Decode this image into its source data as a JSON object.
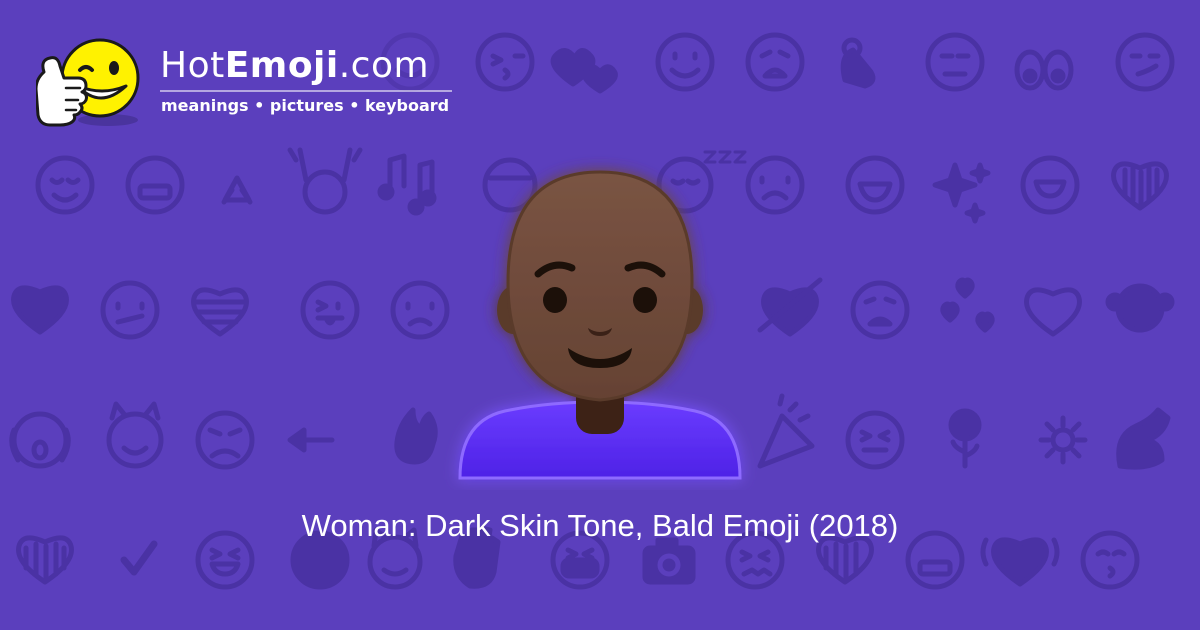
{
  "logo": {
    "name_part1": "Hot",
    "name_part2": "Emoji",
    "name_part3": ".com",
    "tagline": "meanings • pictures • keyboard",
    "mascot_icon": "thumbs-up-winking-smiley-icon"
  },
  "caption": "Woman: Dark Skin Tone, Bald Emoji (2018)",
  "featured_emoji_icon": "woman-dark-skin-tone-bald-icon",
  "background_pattern_icons": [
    "smiling-face-icon",
    "winking-kiss-icon",
    "two-hearts-icon",
    "weary-face-icon",
    "ok-hand-icon",
    "neutral-face-icon",
    "eyes-icon",
    "smirking-face-icon",
    "relieved-face-icon",
    "recycle-icon",
    "raising-hands-icon",
    "music-notes-icon",
    "sleeping-face-icon",
    "sparkles-icon",
    "heart-icon",
    "broken-heart-icon",
    "confused-face-icon",
    "tongue-face-icon",
    "frowning-face-icon",
    "heart-arrow-icon",
    "see-no-evil-monkey-icon",
    "scream-face-icon",
    "smiling-imp-icon",
    "angry-face-icon",
    "left-arrow-icon",
    "fire-icon",
    "party-popper-icon",
    "rose-icon",
    "sun-icon",
    "flexed-biceps-icon",
    "check-mark-icon",
    "grinning-squint-icon",
    "cat-face-icon",
    "waving-hand-icon",
    "camera-icon",
    "kissing-face-icon"
  ],
  "colors": {
    "background": "#5b3fbd",
    "pattern": "#4a32a3",
    "skin": "#6e4a3a",
    "shirt": "#5b2df0",
    "mascot": "#fff200"
  }
}
